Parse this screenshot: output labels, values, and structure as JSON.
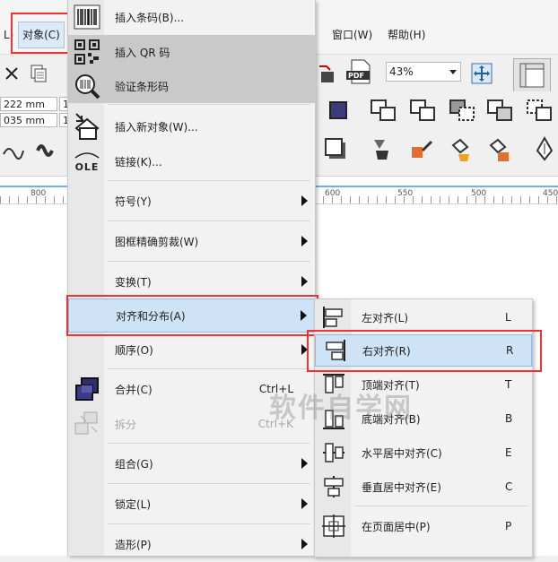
{
  "menubar": {
    "left_fragment": "L)",
    "object_menu": "对象(C)",
    "window_menu": "窗口(W)",
    "help_menu": "帮助(H)"
  },
  "toolbar": {
    "zoom_value": "43%",
    "pdf_label": "PDF",
    "width_value": "222 mm",
    "height_value": "035 mm",
    "small_field_1": "1",
    "small_field_2": "1"
  },
  "ruler": {
    "labels": [
      "800",
      "600",
      "550",
      "500",
      "450"
    ]
  },
  "main_menu": {
    "items": [
      {
        "label": "插入条码(B)...",
        "icon": "barcode-icon"
      },
      {
        "label": "插入 QR 码",
        "icon": "qr-code-icon"
      },
      {
        "label": "验证条形码",
        "icon": "magnify-barcode-icon"
      },
      {
        "label": "插入新对象(W)...",
        "icon": "insert-object-icon"
      },
      {
        "label": "链接(K)...",
        "icon": "ole-icon",
        "icon_text": "OLE"
      },
      {
        "label": "符号(Y)"
      },
      {
        "label": "图框精确剪裁(W)"
      },
      {
        "label": "变换(T)"
      },
      {
        "label": "对齐和分布(A)"
      },
      {
        "label": "顺序(O)"
      },
      {
        "label": "合并(C)",
        "shortcut": "Ctrl+L",
        "icon": "combine-icon"
      },
      {
        "label": "拆分",
        "shortcut": "Ctrl+K",
        "icon": "break-apart-icon"
      },
      {
        "label": "组合(G)"
      },
      {
        "label": "锁定(L)"
      },
      {
        "label": "造形(P)"
      }
    ]
  },
  "sub_menu": {
    "items": [
      {
        "label": "左对齐(L)",
        "key": "L",
        "icon": "align-left-icon"
      },
      {
        "label": "右对齐(R)",
        "key": "R",
        "icon": "align-right-icon"
      },
      {
        "label": "顶端对齐(T)",
        "key": "T",
        "icon": "align-top-icon"
      },
      {
        "label": "底端对齐(B)",
        "key": "B",
        "icon": "align-bottom-icon"
      },
      {
        "label": "水平居中对齐(C)",
        "key": "E",
        "icon": "align-center-horizontal-icon"
      },
      {
        "label": "垂直居中对齐(E)",
        "key": "C",
        "icon": "align-center-vertical-icon"
      },
      {
        "label": "在页面居中(P)",
        "key": "P",
        "icon": "center-on-page-icon"
      }
    ]
  },
  "watermark": "软件自学网",
  "colors": {
    "highlight_blue": "#cfe3f7",
    "highlight_gray": "#c9c9c9",
    "annotation_red": "#e33333",
    "ruler_blue": "#6fb3e6"
  }
}
